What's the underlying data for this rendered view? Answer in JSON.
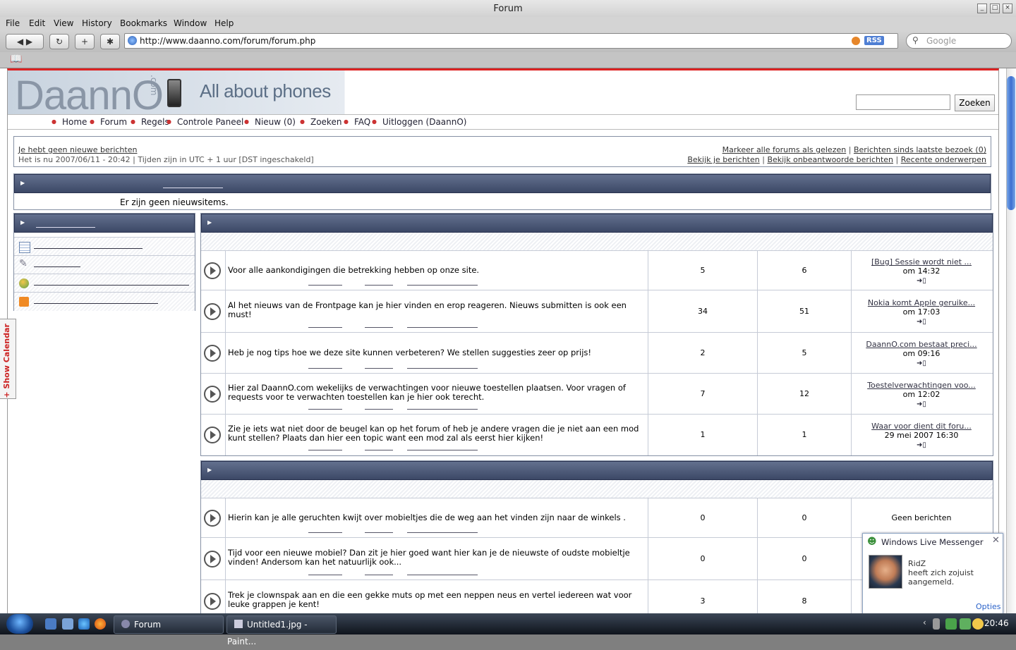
{
  "window": {
    "title": "Forum"
  },
  "menu": [
    "File",
    "Edit",
    "View",
    "History",
    "Bookmarks",
    "Window",
    "Help"
  ],
  "browser": {
    "url": "http://www.daanno.com/forum/forum.php",
    "rss": "RSS",
    "search_placeholder": "Google"
  },
  "site": {
    "logo": "DaannO",
    "logo_com": ".com",
    "tagline": "All about phones",
    "search_button": "Zoeken",
    "nav": [
      "Home",
      "Forum",
      "Regels",
      "Controle Paneel",
      "Nieuw (0)",
      "Zoeken",
      "FAQ",
      "Uitloggen (DaannO)"
    ]
  },
  "info": {
    "no_new": "Je hebt geen nieuwe berichten",
    "time_prefix": "Het is nu 2007/06/11 - 20:42",
    "timezone": "Tijden zijn in UTC + 1 uur [DST ingeschakeld]",
    "mark_read": "Markeer alle forums als gelezen",
    "since_last": "Berichten sinds laatste bezoek (0)",
    "view_own": "Bekijk je berichten",
    "unanswered": "Bekijk onbeantwoorde berichten",
    "recent": "Recente onderwerpen"
  },
  "news": {
    "empty": "Er zijn geen nieuwsitems."
  },
  "calendar_tab": "+ Show Calendar",
  "forums1": [
    {
      "desc": "Voor alle aankondigingen die betrekking hebben op onze site.",
      "topics": "5",
      "posts": "6",
      "last_title": "[Bug] Sessie wordt niet ...",
      "last_time": "om 14:32"
    },
    {
      "desc": "Al het nieuws van de Frontpage kan je hier vinden en erop reageren. Nieuws submitten is ook een must!",
      "topics": "34",
      "posts": "51",
      "last_title": "Nokia komt Apple geruike...",
      "last_time": "om 17:03"
    },
    {
      "desc": "Heb je nog tips hoe we deze site kunnen verbeteren? We stellen suggesties zeer op prijs!",
      "topics": "2",
      "posts": "5",
      "last_title": "DaannO.com bestaat preci...",
      "last_time": "om 09:16"
    },
    {
      "desc": "Hier zal DaannO.com wekelijks de verwachtingen voor nieuwe toestellen plaatsen. Voor vragen of requests voor te verwachten toestellen kan je hier ook terecht.",
      "topics": "7",
      "posts": "12",
      "last_title": "Toestelverwachtingen voo...",
      "last_time": "om 12:02"
    },
    {
      "desc": "Zie je iets wat niet door de beugel kan op het forum of heb je andere vragen die je niet aan een mod kunt stellen? Plaats dan hier een topic want een mod zal als eerst hier kijken!",
      "topics": "1",
      "posts": "1",
      "last_title": "Waar voor dient dit foru...",
      "last_time": "29 mei 2007 16:30"
    }
  ],
  "forums2": [
    {
      "desc": "Hierin kan je alle geruchten kwijt over mobieltjes die de weg aan het vinden zijn naar de winkels .",
      "topics": "0",
      "posts": "0",
      "last_title": "",
      "last_time": "Geen berichten"
    },
    {
      "desc": "Tijd voor een nieuwe mobiel? Dan zit je hier goed want hier kan je de nieuwste of oudste mobieltje vinden! Andersom kan het natuurlijk ook...",
      "topics": "0",
      "posts": "0",
      "last_title": "",
      "last_time": ""
    },
    {
      "desc": "Trek je clownspak aan en die een gekke muts op met een neppen neus en vertel iedereen wat voor leuke grappen je kent!",
      "topics": "3",
      "posts": "8",
      "last_title": "",
      "last_time": ""
    }
  ],
  "messenger": {
    "title": "Windows Live Messenger",
    "user": "RidZ",
    "message": " heeft zich zojuist aangemeld.",
    "options": "Opties"
  },
  "taskbar": {
    "tasks": [
      "Forum",
      "Untitled1.jpg - Paint..."
    ],
    "clock": "20:46"
  }
}
